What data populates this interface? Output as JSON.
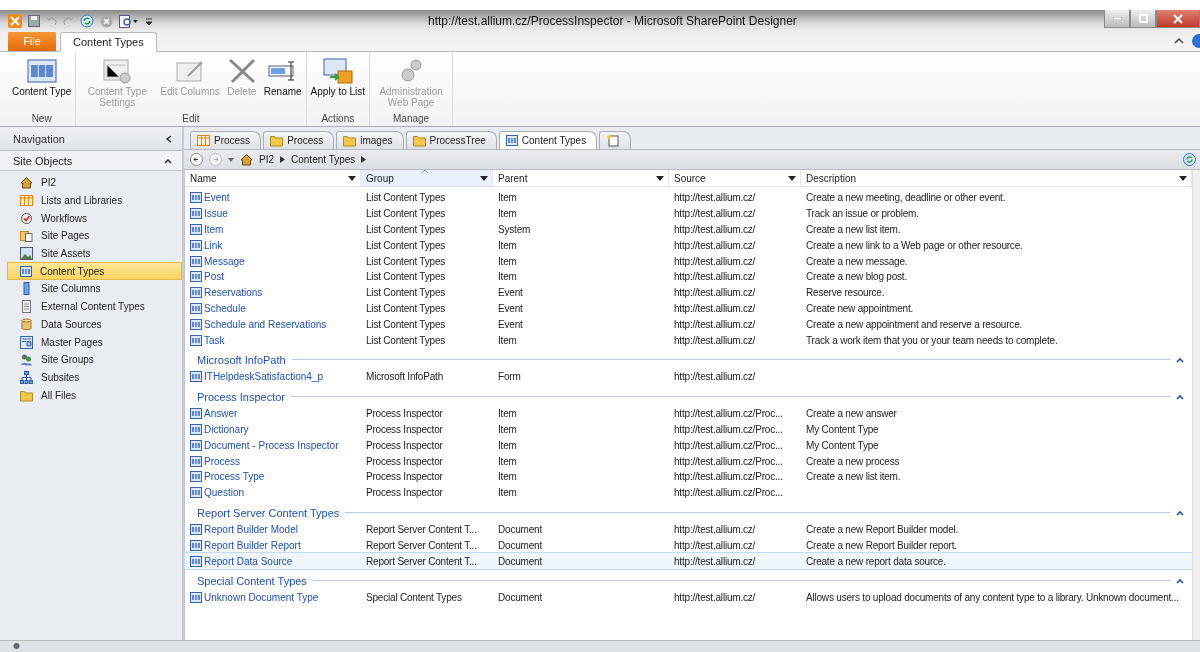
{
  "window": {
    "title": "http://test.allium.cz/ProcessInspector  -  Microsoft SharePoint Designer"
  },
  "ribbon_tabs": [
    {
      "label": "File",
      "kind": "file",
      "selected": false
    },
    {
      "label": "Content Types",
      "kind": "tab",
      "selected": true
    }
  ],
  "ribbon_groups": [
    {
      "label": "New",
      "buttons": [
        {
          "label": "Content Type",
          "kind": "contenttype",
          "disabled": false
        }
      ]
    },
    {
      "label": "Edit",
      "buttons": [
        {
          "label": "Content Type Settings",
          "kind": "settings",
          "disabled": true
        },
        {
          "label": "Edit Columns",
          "kind": "edit",
          "disabled": true
        },
        {
          "label": "Delete",
          "kind": "delete",
          "disabled": true
        },
        {
          "label": "Rename",
          "kind": "rename",
          "disabled": false
        }
      ]
    },
    {
      "label": "Actions",
      "buttons": [
        {
          "label": "Apply to List",
          "kind": "apply",
          "disabled": false
        }
      ]
    },
    {
      "label": "Manage",
      "buttons": [
        {
          "label": "Administration Web Page",
          "kind": "gears",
          "disabled": true
        }
      ]
    }
  ],
  "navigation": {
    "title": "Navigation",
    "section": "Site Objects",
    "items": [
      {
        "label": "PI2",
        "kind": "home",
        "selected": false
      },
      {
        "label": "Lists and Libraries",
        "kind": "list",
        "selected": false
      },
      {
        "label": "Workflows",
        "kind": "workflow",
        "selected": false
      },
      {
        "label": "Site Pages",
        "kind": "pages",
        "selected": false
      },
      {
        "label": "Site Assets",
        "kind": "assets",
        "selected": false
      },
      {
        "label": "Content Types",
        "kind": "contenttype",
        "selected": true
      },
      {
        "label": "Site Columns",
        "kind": "column",
        "selected": false
      },
      {
        "label": "External Content Types",
        "kind": "external",
        "selected": false
      },
      {
        "label": "Data Sources",
        "kind": "datasource",
        "selected": false
      },
      {
        "label": "Master Pages",
        "kind": "master",
        "selected": false
      },
      {
        "label": "Site Groups",
        "kind": "groups",
        "selected": false
      },
      {
        "label": "Subsites",
        "kind": "subsites",
        "selected": false
      },
      {
        "label": "All Files",
        "kind": "folder",
        "selected": false
      }
    ]
  },
  "doc_tabs": [
    {
      "label": "Process",
      "kind": "list",
      "selected": false
    },
    {
      "label": "Process",
      "kind": "folder",
      "selected": false
    },
    {
      "label": "images",
      "kind": "folder",
      "selected": false
    },
    {
      "label": "ProcessTree",
      "kind": "folder",
      "selected": false
    },
    {
      "label": "Content Types",
      "kind": "contenttype",
      "selected": true
    }
  ],
  "breadcrumb": [
    "PI2",
    "Content Types"
  ],
  "table": {
    "columns": [
      {
        "label": "Name",
        "sorted": false
      },
      {
        "label": "Group",
        "sorted": true
      },
      {
        "label": "Parent",
        "sorted": false
      },
      {
        "label": "Source",
        "sorted": false
      },
      {
        "label": "Description",
        "sorted": false
      }
    ],
    "groups": [
      {
        "rows": [
          {
            "cells": [
              "Event",
              "List Content Types",
              "Item",
              "http://test.allium.cz/",
              "Create a new meeting, deadline or other event."
            ],
            "selected": false
          },
          {
            "cells": [
              "Issue",
              "List Content Types",
              "Item",
              "http://test.allium.cz/",
              "Track an issue or problem."
            ],
            "selected": false
          },
          {
            "cells": [
              "Item",
              "List Content Types",
              "System",
              "http://test.allium.cz/",
              "Create a new list item."
            ],
            "selected": false
          },
          {
            "cells": [
              "Link",
              "List Content Types",
              "Item",
              "http://test.allium.cz/",
              "Create a new link to a Web page or other resource."
            ],
            "selected": false
          },
          {
            "cells": [
              "Message",
              "List Content Types",
              "Item",
              "http://test.allium.cz/",
              "Create a new message."
            ],
            "selected": false
          },
          {
            "cells": [
              "Post",
              "List Content Types",
              "Item",
              "http://test.allium.cz/",
              "Create a new blog post."
            ],
            "selected": false
          },
          {
            "cells": [
              "Reservations",
              "List Content Types",
              "Event",
              "http://test.allium.cz/",
              "Reserve resource."
            ],
            "selected": false
          },
          {
            "cells": [
              "Schedule",
              "List Content Types",
              "Event",
              "http://test.allium.cz/",
              "Create new appointment."
            ],
            "selected": false
          },
          {
            "cells": [
              "Schedule and Reservations",
              "List Content Types",
              "Event",
              "http://test.allium.cz/",
              "Create a new appointment and reserve a resource."
            ],
            "selected": false
          },
          {
            "cells": [
              "Task",
              "List Content Types",
              "Item",
              "http://test.allium.cz/",
              "Track a work item that you or your team needs to complete."
            ],
            "selected": false
          }
        ]
      },
      {
        "title": "Microsoft InfoPath",
        "expanded": true,
        "rows": [
          {
            "cells": [
              "ITHelpdeskSatisfaction4_p",
              "Microsoft InfoPath",
              "Form",
              "http://test.allium.cz/",
              ""
            ],
            "selected": false
          }
        ]
      },
      {
        "title": "Process Inspector",
        "expanded": true,
        "rows": [
          {
            "cells": [
              "Answer",
              "Process Inspector",
              "Item",
              "http://test.allium.cz/Proc...",
              "Create a new answer"
            ],
            "selected": false
          },
          {
            "cells": [
              "Dictionary",
              "Process Inspector",
              "Item",
              "http://test.allium.cz/Proc...",
              "My Content Type"
            ],
            "selected": false
          },
          {
            "cells": [
              "Document - Process Inspector",
              "Process Inspector",
              "Item",
              "http://test.allium.cz/Proc...",
              "My Content Type"
            ],
            "selected": false
          },
          {
            "cells": [
              "Process",
              "Process Inspector",
              "Item",
              "http://test.allium.cz/Proc...",
              "Create a new process"
            ],
            "selected": false
          },
          {
            "cells": [
              "Process Type",
              "Process Inspector",
              "Item",
              "http://test.allium.cz/Proc...",
              "Create a new list item."
            ],
            "selected": false
          },
          {
            "cells": [
              "Question",
              "Process Inspector",
              "Item",
              "http://test.allium.cz/Proc...",
              ""
            ],
            "selected": false
          }
        ]
      },
      {
        "title": "Report Server Content Types",
        "expanded": true,
        "rows": [
          {
            "cells": [
              "Report Builder Model",
              "Report Server Content T...",
              "Document",
              "http://test.allium.cz/",
              "Create a new Report Builder model."
            ],
            "selected": false
          },
          {
            "cells": [
              "Report Builder Report",
              "Report Server Content T...",
              "Document",
              "http://test.allium.cz/",
              "Create a new Report Builder report."
            ],
            "selected": false
          },
          {
            "cells": [
              "Report Data Source",
              "Report Server Content T...",
              "Document",
              "http://test.allium.cz/",
              "Create a new report data source."
            ],
            "selected": true
          }
        ]
      },
      {
        "title": "Special Content Types",
        "expanded": true,
        "rows": [
          {
            "cells": [
              "Unknown Document Type",
              "Special Content Types",
              "Document",
              "http://test.allium.cz/",
              "Allows users to upload documents of any content type to a library. Unknown document..."
            ],
            "selected": false
          }
        ]
      }
    ]
  }
}
